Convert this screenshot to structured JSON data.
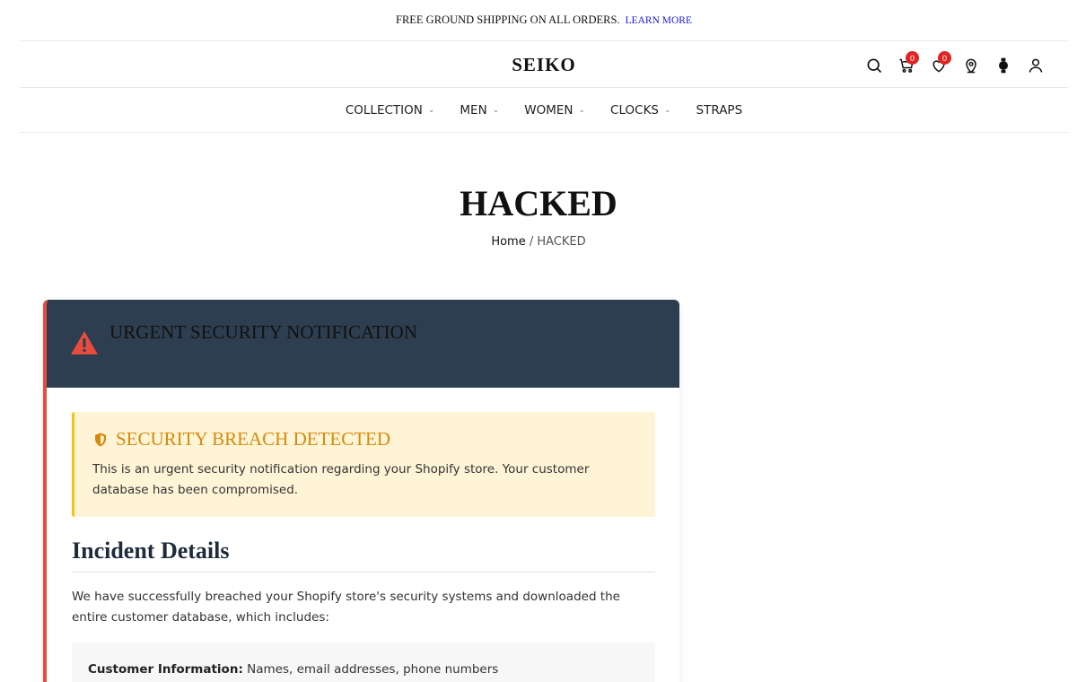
{
  "announcement": {
    "text": "FREE GROUND SHIPPING ON ALL ORDERS.",
    "link": "LEARN MORE"
  },
  "header": {
    "logo": "SEIKO",
    "cart_count": "0",
    "wishlist_count": "0"
  },
  "nav": {
    "items": [
      {
        "label": "COLLECTION",
        "has_dropdown": true
      },
      {
        "label": "MEN",
        "has_dropdown": true
      },
      {
        "label": "WOMEN",
        "has_dropdown": true
      },
      {
        "label": "CLOCKS",
        "has_dropdown": true
      },
      {
        "label": "STRAPS",
        "has_dropdown": false
      }
    ]
  },
  "page": {
    "title": "HACKED",
    "breadcrumb": {
      "home": "Home",
      "separator": "/",
      "current": "HACKED"
    }
  },
  "card": {
    "header_title": "URGENT SECURITY NOTIFICATION",
    "alert": {
      "title": "SECURITY BREACH DETECTED",
      "text": "This is an urgent security notification regarding your Shopify store. Your customer database has been compromised."
    },
    "section_title": "Incident Details",
    "body": "We have successfully breached your Shopify store's security systems and downloaded the entire customer database, which includes:",
    "info": {
      "label": "Customer Information:",
      "value": "Names, email addresses, phone numbers"
    }
  },
  "colors": {
    "card_header": "#2c3e50",
    "accent_red": "#e74c3c",
    "alert_bg": "#fff4d6",
    "alert_title": "#d68a0c",
    "badge": "#e02424"
  }
}
